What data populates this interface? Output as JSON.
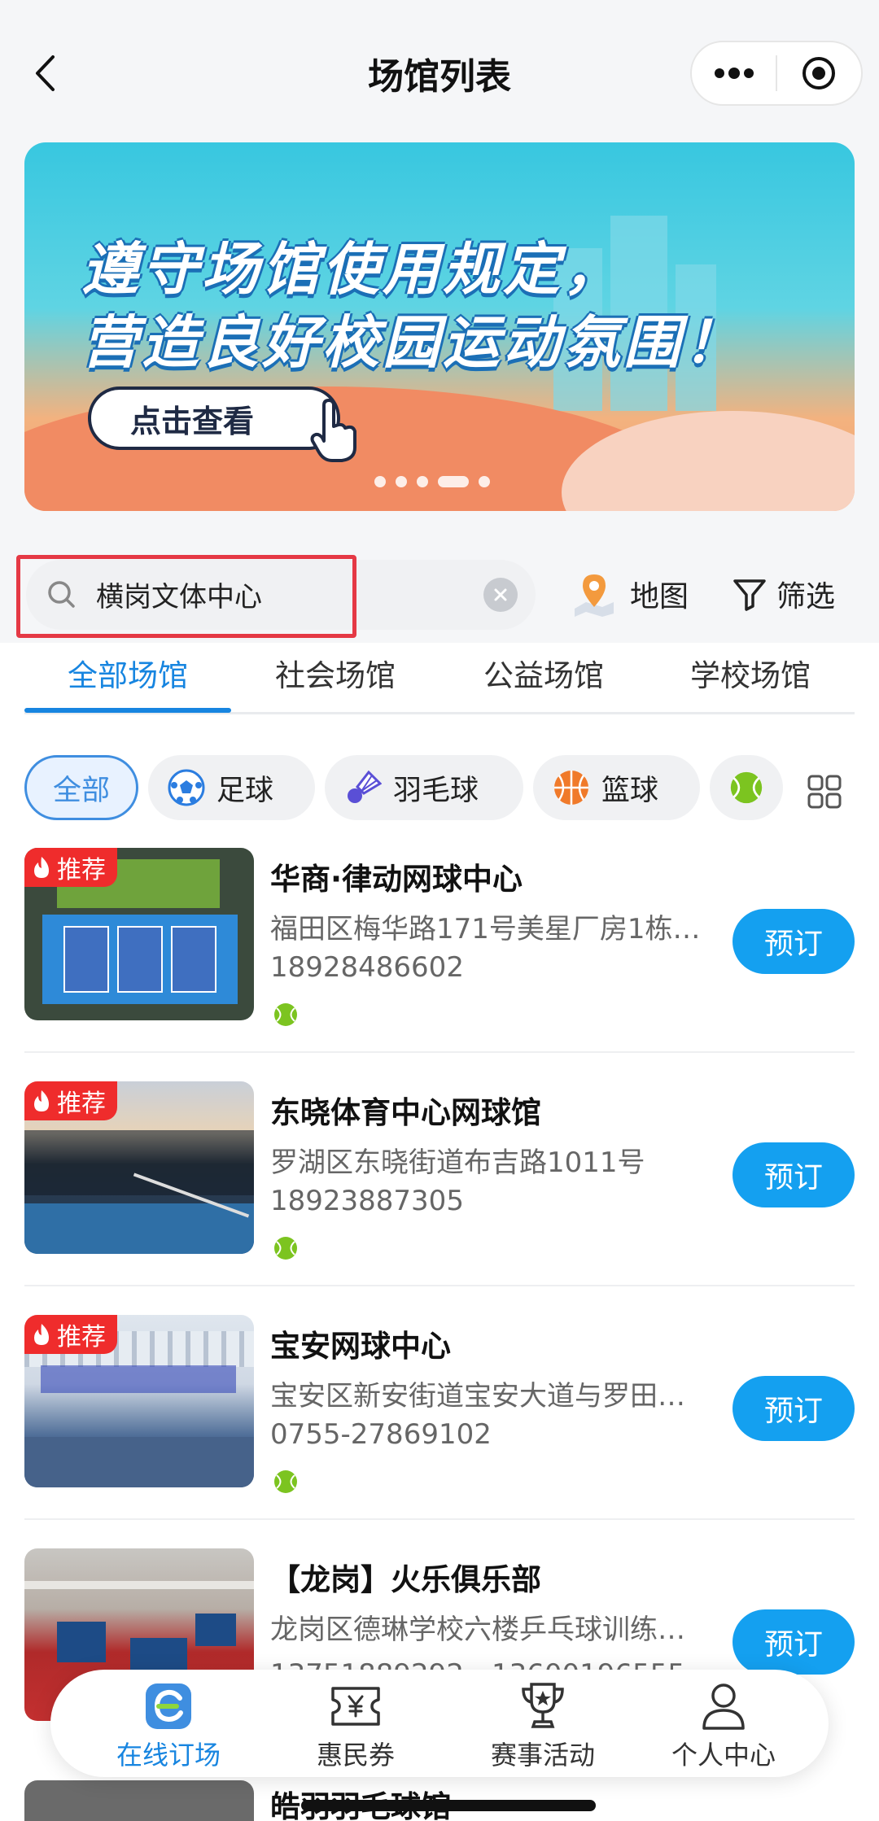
{
  "nav": {
    "title": "场馆列表"
  },
  "banner": {
    "line1": "遵守场馆使用规定，",
    "line2": "营造良好校园运动氛围！",
    "cta": "点击查看"
  },
  "search": {
    "value": "横岗文体中心"
  },
  "actions": {
    "map": "地图",
    "filter": "筛选"
  },
  "tabs": [
    "全部场馆",
    "社会场馆",
    "公益场馆",
    "学校场馆"
  ],
  "chips": [
    {
      "label": "全部"
    },
    {
      "label": "足球"
    },
    {
      "label": "羽毛球"
    },
    {
      "label": "篮球"
    }
  ],
  "venues": [
    {
      "badge": "推荐",
      "name": "华商·律动网球中心",
      "address": "福田区梅华路171号美星厂房1栋…",
      "phone": "18928486602",
      "book": "预订"
    },
    {
      "badge": "推荐",
      "name": "东晓体育中心网球馆",
      "address": "罗湖区东晓街道布吉路1011号",
      "phone": "18923887305",
      "book": "预订"
    },
    {
      "badge": "推荐",
      "name": "宝安网球中心",
      "address": "宝安区新安街道宝安大道与罗田…",
      "phone": "0755-27869102",
      "book": "预订"
    },
    {
      "name": "【龙岗】火乐俱乐部",
      "address": "龙岗区德琳学校六楼乒乓球训练…",
      "phone": "13751889292，13600196555",
      "book": "预订"
    }
  ],
  "partial_venue": {
    "name": "皓羽羽毛球馆"
  },
  "bottom_nav": [
    "在线订场",
    "惠民券",
    "赛事活动",
    "个人中心"
  ],
  "colors": {
    "primary": "#1785e0",
    "book_button": "#14a0f0",
    "badge": "#ef2c2c",
    "search_highlight": "#e53945"
  }
}
